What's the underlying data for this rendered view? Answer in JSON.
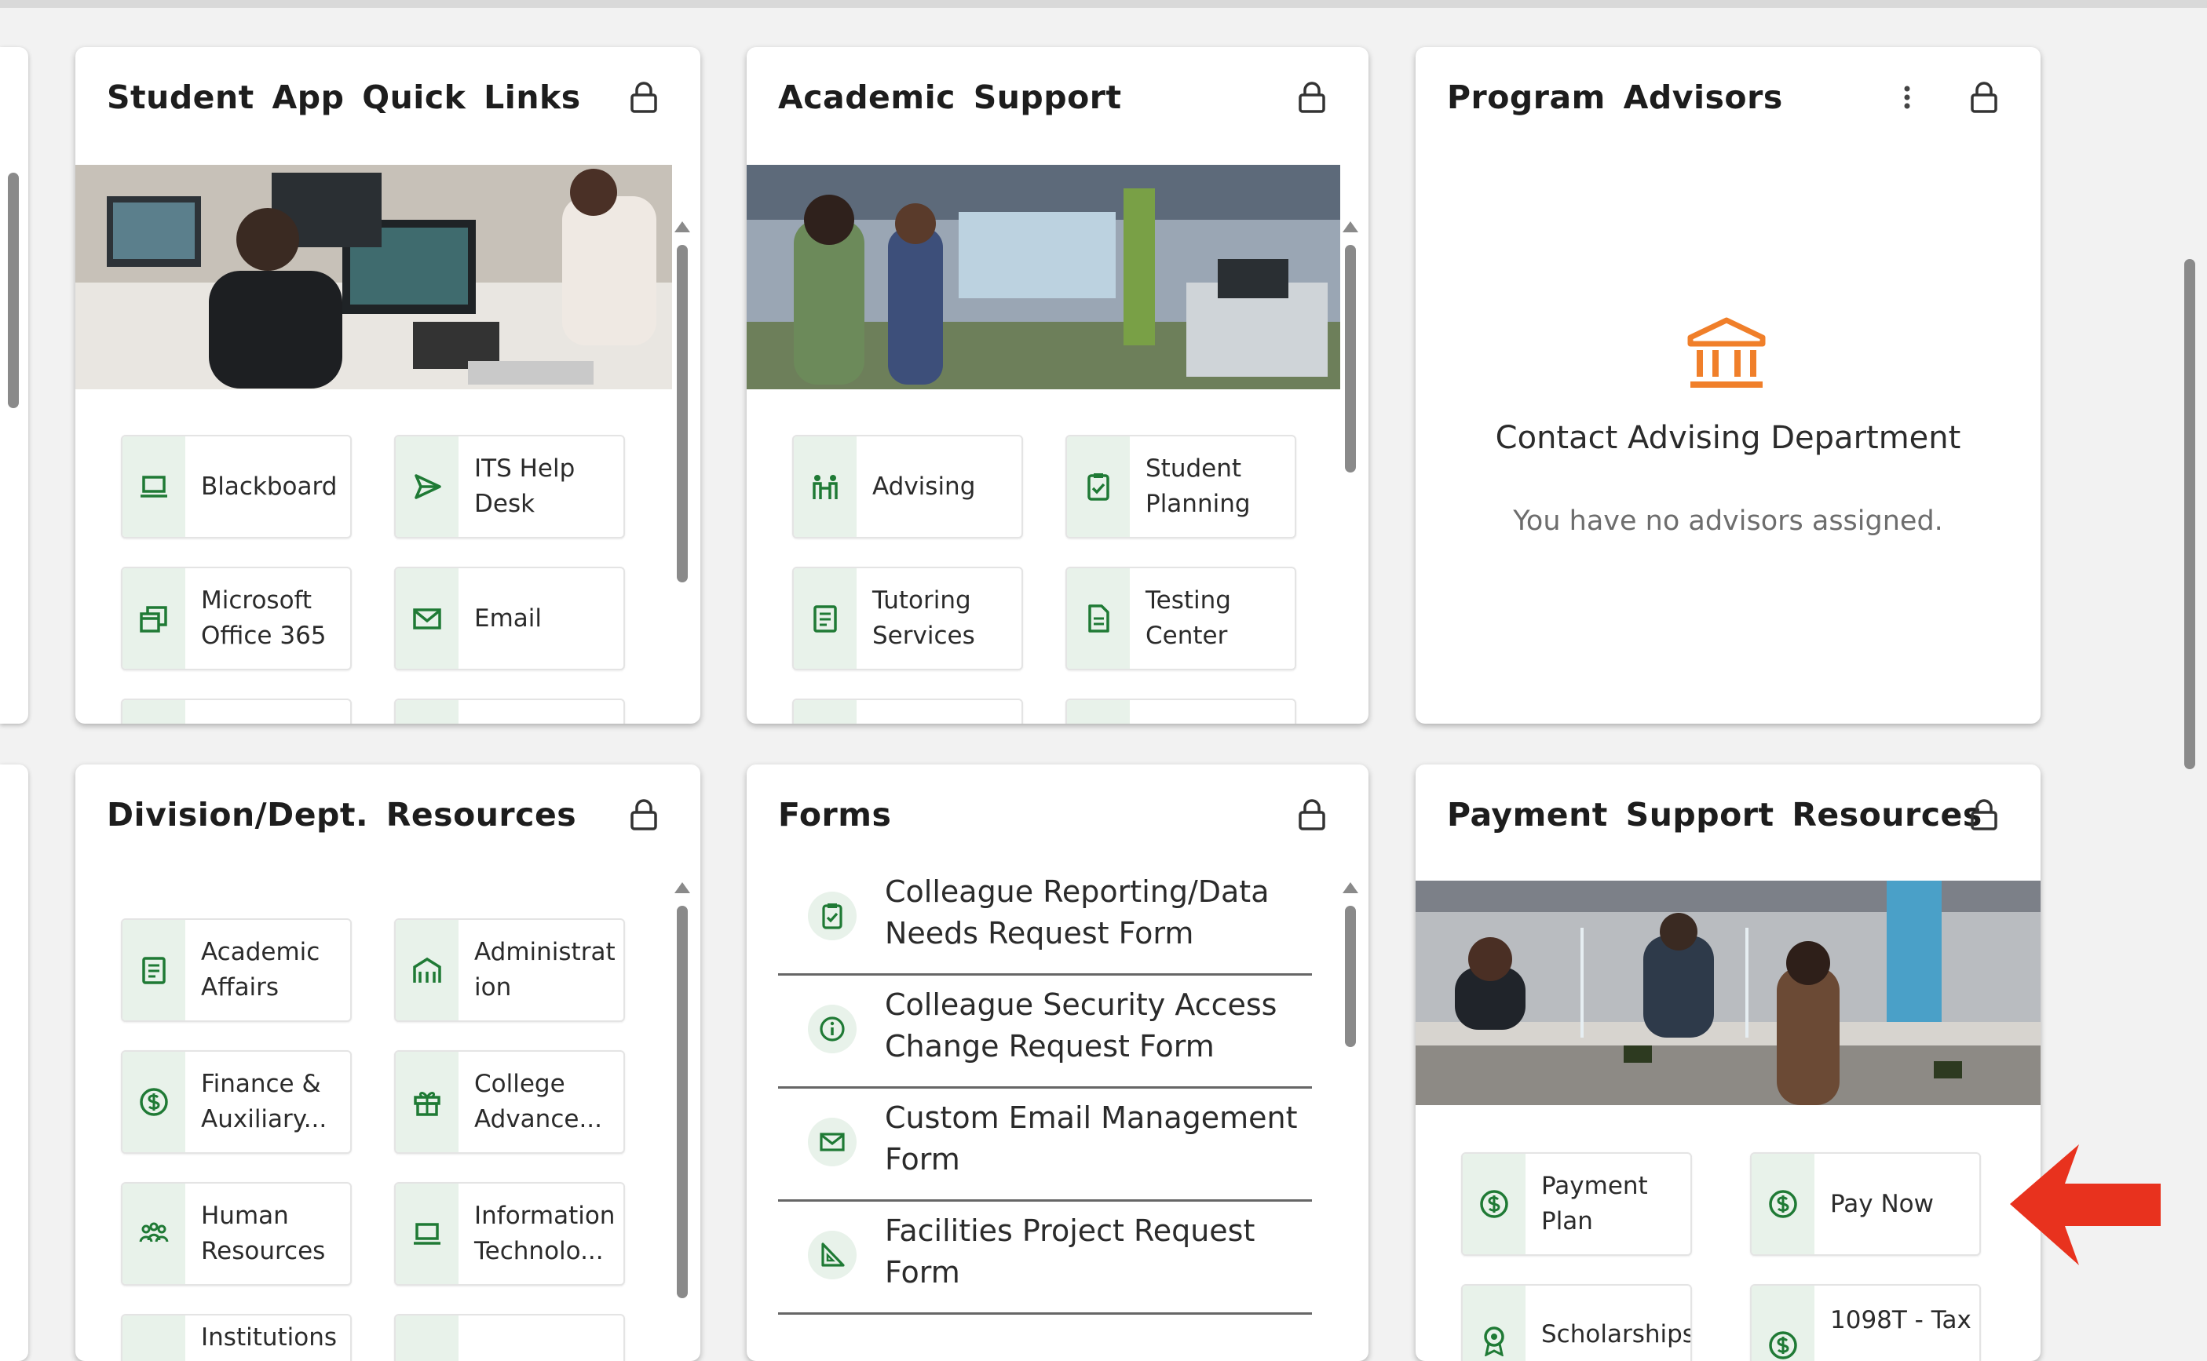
{
  "colors": {
    "accent_green": "#1f7a35",
    "icon_bg": "#e8f2ea",
    "advisor_icon": "#f07f2a",
    "arrow": "#e8321e"
  },
  "cards": {
    "quick_links": {
      "title": "Student App Quick Links",
      "tiles": [
        {
          "label": "Blackboard",
          "icon": "laptop-icon"
        },
        {
          "label": "ITS Help Desk",
          "icon": "send-icon"
        },
        {
          "label": "Microsoft Office 365",
          "icon": "office-icon"
        },
        {
          "label": "Email",
          "icon": "mail-icon"
        }
      ]
    },
    "academic_support": {
      "title": "Academic Support",
      "tiles": [
        {
          "label": "Advising",
          "icon": "people-icon"
        },
        {
          "label": "Student Planning",
          "icon": "clipboard-icon"
        },
        {
          "label": "Tutoring Services",
          "icon": "book-icon"
        },
        {
          "label": "Testing Center",
          "icon": "document-icon"
        }
      ]
    },
    "program_advisors": {
      "title": "Program Advisors",
      "contact": "Contact Advising Department",
      "empty": "You have no advisors assigned.",
      "icon": "bank-icon"
    },
    "division": {
      "title": "Division/Dept. Resources",
      "tiles": [
        {
          "label": "Academic Affairs",
          "icon": "book-icon"
        },
        {
          "label": "Administrat ion",
          "icon": "building-icon"
        },
        {
          "label": "Finance & Auxiliary...",
          "icon": "dollar-icon"
        },
        {
          "label": "College Advance...",
          "icon": "gift-icon"
        },
        {
          "label": "Human Resources",
          "icon": "group-icon"
        },
        {
          "label": "Information Technolo...",
          "icon": "laptop-icon"
        },
        {
          "label": "Institutions",
          "icon": "book-icon"
        },
        {
          "label": "",
          "icon": "book-icon"
        }
      ]
    },
    "forms": {
      "title": "Forms",
      "items": [
        {
          "label": "Colleague Reporting/Data Needs Request Form",
          "icon": "clipboard-icon"
        },
        {
          "label": "Colleague Security Access Change Request Form",
          "icon": "info-icon"
        },
        {
          "label": "Custom Email Management Form",
          "icon": "mail-icon"
        },
        {
          "label": "Facilities Project Request Form",
          "icon": "triangle-ruler-icon"
        }
      ]
    },
    "payment": {
      "title": "Payment Support Resources",
      "tiles": [
        {
          "label": "Payment Plan",
          "icon": "dollar-icon"
        },
        {
          "label": "Pay Now",
          "icon": "dollar-icon"
        },
        {
          "label": "Scholarships",
          "icon": "award-icon"
        },
        {
          "label": "1098T - Tax",
          "icon": "dollar-icon"
        }
      ]
    }
  }
}
